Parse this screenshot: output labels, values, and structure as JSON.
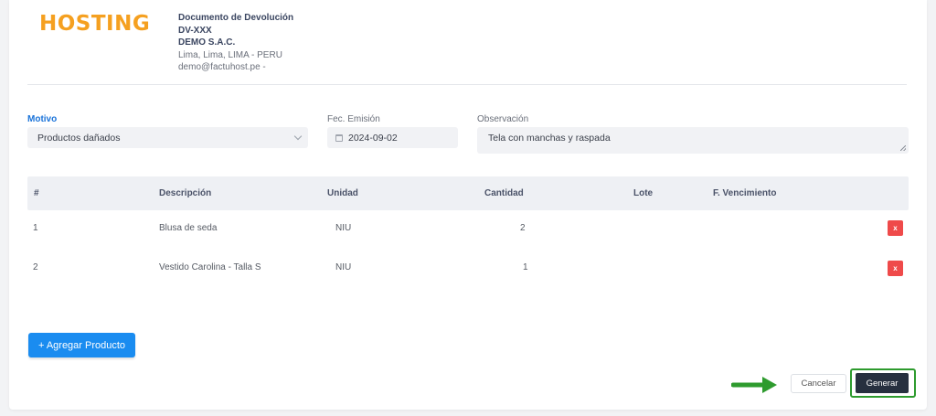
{
  "header": {
    "logo_text": "HOSTING",
    "doc_title": "Documento de Devolución",
    "doc_number": "DV-XXX",
    "company": "DEMO S.A.C.",
    "address": "Lima, Lima, LIMA - PERU",
    "email": "demo@factuhost.pe -"
  },
  "form": {
    "motivo_label": "Motivo",
    "motivo_value": "Productos dañados",
    "fecha_label": "Fec. Emisión",
    "fecha_value": "2024-09-02",
    "obs_label": "Observación",
    "obs_value": "Tela con manchas y raspada"
  },
  "table": {
    "headers": [
      "#",
      "Descripción",
      "Unidad",
      "Cantidad",
      "Lote",
      "F. Vencimiento"
    ],
    "rows": [
      {
        "num": "1",
        "desc": "Blusa de seda",
        "unit": "NIU",
        "qty": "2",
        "lote": "",
        "venc": "",
        "delete_label": "x"
      },
      {
        "num": "2",
        "desc": "Vestido Carolina - Talla S",
        "unit": "NIU",
        "qty": "1",
        "lote": "",
        "venc": "",
        "delete_label": "x"
      }
    ]
  },
  "actions": {
    "add_label": "+ Agregar Producto",
    "cancel_label": "Cancelar",
    "generate_label": "Generar"
  },
  "colors": {
    "logo": "#f5a020",
    "primary": "#1a8cf0",
    "danger": "#ef4a4a",
    "dark_button": "#27303f",
    "highlight": "#2e9b2e"
  }
}
